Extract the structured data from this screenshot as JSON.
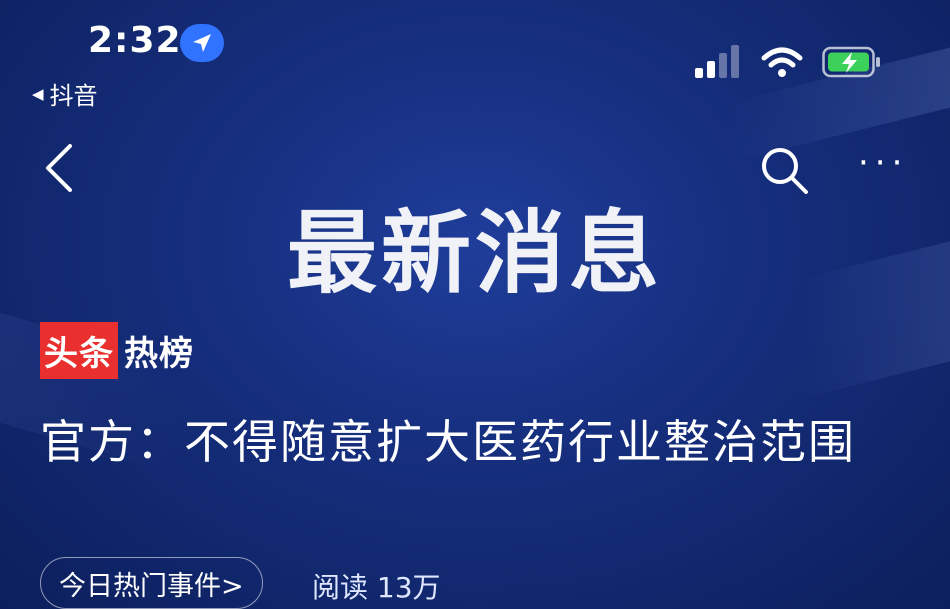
{
  "status_bar": {
    "time": "2:32",
    "back_app": "抖音",
    "icons": [
      "location-arrow-icon",
      "cellular-signal-icon",
      "wifi-icon",
      "battery-charging-icon"
    ]
  },
  "nav": {
    "icons": [
      "back-chevron-icon",
      "search-icon",
      "more-icon"
    ]
  },
  "video": {
    "headline": "最新消息"
  },
  "badge": {
    "red_text": "头条",
    "text": "热榜"
  },
  "article": {
    "title": "官方：不得随意扩大医药行业整治范围"
  },
  "meta": {
    "topic": "今日热门事件>",
    "reads": "阅读 13万"
  },
  "colors": {
    "background": "#162f7e",
    "badge_red": "#ea2f2f",
    "location_blue": "#2f73ff",
    "battery_green": "#3bd15a"
  }
}
